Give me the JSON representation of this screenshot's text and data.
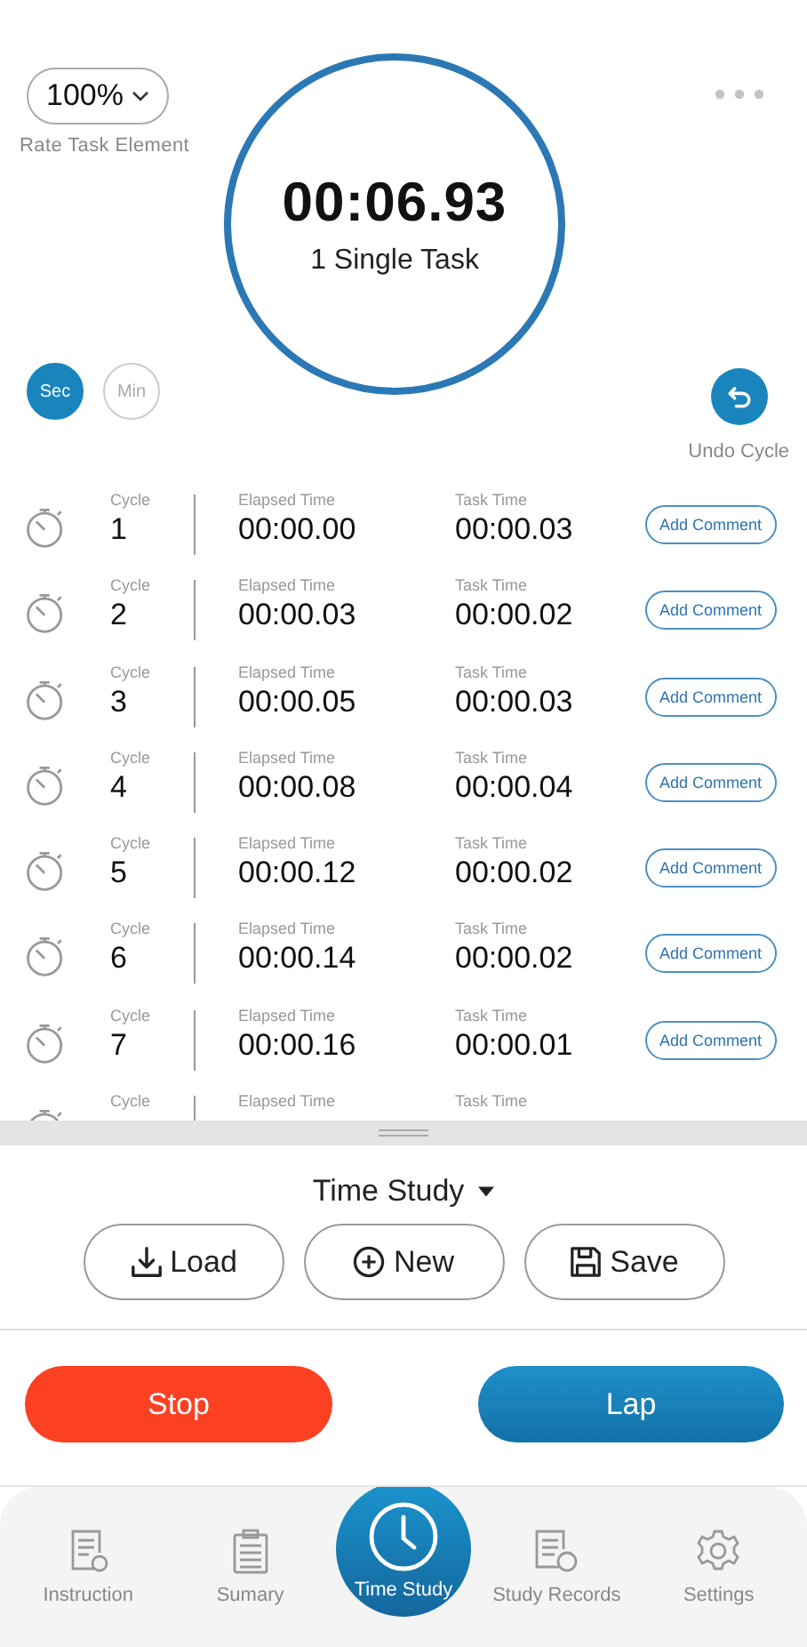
{
  "rate": {
    "value": "100%",
    "label": "Rate Task Element"
  },
  "timer": {
    "time": "00:06.93",
    "task": "1 Single Task"
  },
  "units": [
    {
      "label": "Sec",
      "selected": true
    },
    {
      "label": "Min",
      "selected": false
    }
  ],
  "undo": {
    "label": "Undo Cycle"
  },
  "rows": [
    {
      "cycle_label": "Cycle",
      "cycle": "1",
      "elapsed_label": "Elapsed Time",
      "elapsed": "00:00.00",
      "task_label": "Task Time",
      "task": "00:00.03",
      "button": "Add Comment"
    },
    {
      "cycle_label": "Cycle",
      "cycle": "2",
      "elapsed_label": "Elapsed Time",
      "elapsed": "00:00.03",
      "task_label": "Task Time",
      "task": "00:00.02",
      "button": "Add Comment"
    },
    {
      "cycle_label": "Cycle",
      "cycle": "3",
      "elapsed_label": "Elapsed Time",
      "elapsed": "00:00.05",
      "task_label": "Task Time",
      "task": "00:00.03",
      "button": "Add Comment"
    },
    {
      "cycle_label": "Cycle",
      "cycle": "4",
      "elapsed_label": "Elapsed Time",
      "elapsed": "00:00.08",
      "task_label": "Task Time",
      "task": "00:00.04",
      "button": "Add Comment"
    },
    {
      "cycle_label": "Cycle",
      "cycle": "5",
      "elapsed_label": "Elapsed Time",
      "elapsed": "00:00.12",
      "task_label": "Task Time",
      "task": "00:00.02",
      "button": "Add Comment"
    },
    {
      "cycle_label": "Cycle",
      "cycle": "6",
      "elapsed_label": "Elapsed Time",
      "elapsed": "00:00.14",
      "task_label": "Task Time",
      "task": "00:00.02",
      "button": "Add Comment"
    },
    {
      "cycle_label": "Cycle",
      "cycle": "7",
      "elapsed_label": "Elapsed Time",
      "elapsed": "00:00.16",
      "task_label": "Task Time",
      "task": "00:00.01",
      "button": "Add Comment"
    },
    {
      "cycle_label": "Cycle",
      "elapsed_label": "Elapsed Time",
      "task_label": "Task Time"
    }
  ],
  "mode": {
    "title": "Time Study"
  },
  "actions": [
    {
      "kind": "load",
      "label": "Load"
    },
    {
      "kind": "new",
      "label": "New"
    },
    {
      "kind": "save",
      "label": "Save"
    }
  ],
  "stop": "Stop",
  "lap": "Lap",
  "nav": [
    {
      "kind": "instruction",
      "label": "Instruction",
      "selected": false
    },
    {
      "kind": "summary",
      "label": "Sumary",
      "selected": false
    },
    {
      "kind": "timer",
      "label": "Time Study",
      "selected": true
    },
    {
      "kind": "records",
      "label": "Study Records",
      "selected": false
    },
    {
      "kind": "settings",
      "label": "Settings",
      "selected": false
    }
  ]
}
